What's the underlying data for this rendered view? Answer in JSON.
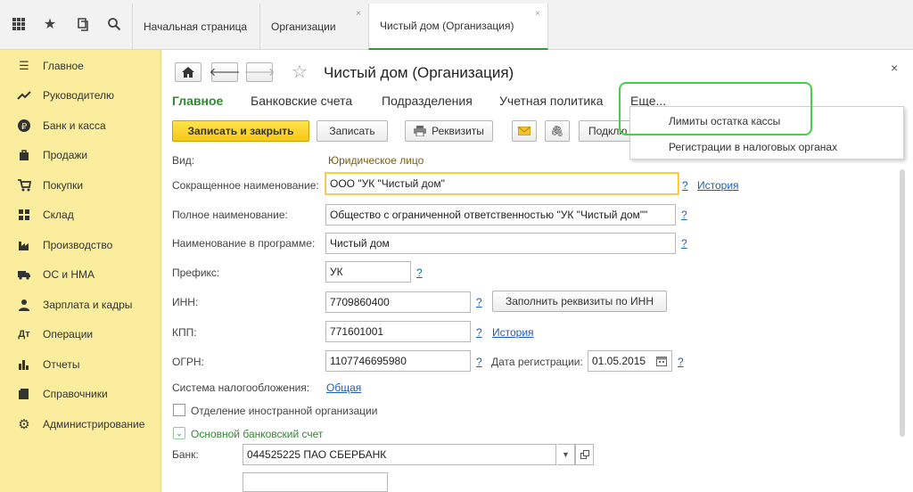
{
  "topbar": {
    "tabs": [
      {
        "label": "Начальная страница",
        "closable": false
      },
      {
        "label": "Организации",
        "closable": true
      },
      {
        "label": "Чистый дом (Организация)",
        "closable": true
      }
    ],
    "close_glyph": "×"
  },
  "sidebar": {
    "items": [
      {
        "label": "Главное",
        "icon": "menu-icon"
      },
      {
        "label": "Руководителю",
        "icon": "trend-icon"
      },
      {
        "label": "Банк и касса",
        "icon": "ruble-icon"
      },
      {
        "label": "Продажи",
        "icon": "bag-icon"
      },
      {
        "label": "Покупки",
        "icon": "cart-icon"
      },
      {
        "label": "Склад",
        "icon": "warehouse-icon"
      },
      {
        "label": "Производство",
        "icon": "factory-icon"
      },
      {
        "label": "ОС и НМА",
        "icon": "truck-icon"
      },
      {
        "label": "Зарплата и кадры",
        "icon": "person-icon"
      },
      {
        "label": "Операции",
        "icon": "operations-icon"
      },
      {
        "label": "Отчеты",
        "icon": "bar-chart-icon"
      },
      {
        "label": "Справочники",
        "icon": "book-icon"
      },
      {
        "label": "Администрирование",
        "icon": "gear-icon"
      }
    ]
  },
  "form": {
    "title": "Чистый дом (Организация)",
    "close": "×",
    "tabs": [
      "Главное",
      "Банковские счета",
      "Подразделения",
      "Учетная политика",
      "Еще..."
    ],
    "buttons": {
      "save_close": "Записать и закрыть",
      "save": "Записать",
      "requisites": "Реквизиты",
      "more": "Подклю"
    },
    "fields": {
      "kind_label": "Вид:",
      "kind_value": "Юридическое лицо",
      "short_name_label": "Сокращенное наименование:",
      "short_name_value": "ООО \"УК \"Чистый дом\"",
      "full_name_label": "Полное наименование:",
      "full_name_value": "Общество с ограниченной ответственностью \"УК \"Чистый дом\"\"",
      "program_name_label": "Наименование в программе:",
      "program_name_value": "Чистый дом",
      "prefix_label": "Префикс:",
      "prefix_value": "УК",
      "inn_label": "ИНН:",
      "inn_value": "7709860400",
      "inn_fill_button": "Заполнить реквизиты по ИНН",
      "kpp_label": "КПП:",
      "kpp_value": "771601001",
      "ogrn_label": "ОГРН:",
      "ogrn_value": "1107746695980",
      "reg_date_label": "Дата регистрации:",
      "reg_date_value": "01.05.2015",
      "tax_system_label": "Система налогообложения:",
      "tax_system_value": "Общая",
      "foreign_branch_label": "Отделение иностранной организации",
      "bank_section_label": "Основной банковский счет",
      "bank_label": "Банк:",
      "bank_value": "044525225 ПАО СБЕРБАНК"
    },
    "help": "?",
    "history": "История"
  },
  "dropdown": {
    "items": [
      "Лимиты остатка кассы",
      "Регистрации в налоговых органах"
    ]
  },
  "colors": {
    "sidebar_bg": "#fbed9e",
    "primary_button": "#f7c916",
    "active_tab": "#2e8b2e",
    "highlight": "#41d341",
    "link": "#1d5fb8"
  }
}
